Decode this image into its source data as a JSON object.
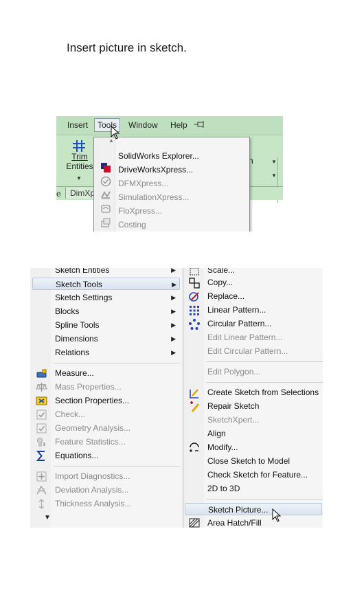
{
  "caption": "Insert picture in sketch.",
  "top": {
    "menubar": [
      "Insert",
      "Tools",
      "Window",
      "Help"
    ],
    "ribbon": {
      "trim_line1": "Trim",
      "trim_line2": "Entities",
      "partial_label": "n"
    },
    "tabs": {
      "partial": "e",
      "dimxpert": "DimXp"
    },
    "tools_menu": [
      {
        "label": "SolidWorks Explorer...",
        "enabled": true
      },
      {
        "label": "DriveWorksXpress...",
        "enabled": true
      },
      {
        "label": "DFMXpress...",
        "enabled": false
      },
      {
        "label": "SimulationXpress...",
        "enabled": false
      },
      {
        "label": "FloXpress...",
        "enabled": false
      },
      {
        "label": "Costing",
        "enabled": false
      }
    ]
  },
  "bottom": {
    "left_menu": [
      {
        "label": "Sketch Entities",
        "submenu": true
      },
      {
        "label": "Sketch Tools",
        "submenu": true,
        "highlighted": true
      },
      {
        "label": "Sketch Settings",
        "submenu": true
      },
      {
        "label": "Blocks",
        "submenu": true
      },
      {
        "label": "Spline Tools",
        "submenu": true
      },
      {
        "label": "Dimensions",
        "submenu": true
      },
      {
        "label": "Relations",
        "submenu": true
      },
      {
        "label": "Measure...",
        "enabled": true,
        "icon": "measure-icon"
      },
      {
        "label": "Mass Properties...",
        "enabled": false,
        "icon": "scale-icon"
      },
      {
        "label": "Section Properties...",
        "enabled": true,
        "icon": "section-properties-icon"
      },
      {
        "label": "Check...",
        "enabled": false,
        "icon": "check-icon"
      },
      {
        "label": "Geometry Analysis...",
        "enabled": false,
        "icon": "geometry-analysis-icon"
      },
      {
        "label": "Feature Statistics...",
        "enabled": false,
        "icon": "feature-statistics-icon"
      },
      {
        "label": "Equations...",
        "enabled": true,
        "icon": "sigma-icon"
      },
      {
        "label": "Import Diagnostics...",
        "enabled": false,
        "icon": "import-diagnostics-icon"
      },
      {
        "label": "Deviation  Analysis...",
        "enabled": false,
        "icon": "deviation-analysis-icon"
      },
      {
        "label": "Thickness Analysis...",
        "enabled": false,
        "icon": "thickness-analysis-icon"
      }
    ],
    "right_menu": [
      {
        "label": "Scale...",
        "enabled": true
      },
      {
        "label": "Copy...",
        "enabled": true
      },
      {
        "label": "Replace...",
        "enabled": true
      },
      {
        "label": "Linear Pattern...",
        "enabled": true
      },
      {
        "label": "Circular Pattern...",
        "enabled": true
      },
      {
        "label": "Edit Linear Pattern...",
        "enabled": false
      },
      {
        "label": "Edit Circular Pattern...",
        "enabled": false
      },
      {
        "label": "Edit Polygon...",
        "enabled": false
      },
      {
        "label": "Create Sketch from Selections",
        "enabled": true
      },
      {
        "label": "Repair Sketch",
        "enabled": true
      },
      {
        "label": "SketchXpert...",
        "enabled": false
      },
      {
        "label": "Align",
        "enabled": true
      },
      {
        "label": "Modify...",
        "enabled": true
      },
      {
        "label": "Close Sketch to Model",
        "enabled": true
      },
      {
        "label": "Check Sketch for Feature...",
        "enabled": true
      },
      {
        "label": "2D to 3D",
        "enabled": true
      },
      {
        "label": "Sketch Picture...",
        "enabled": true,
        "highlighted": true
      },
      {
        "label": "Area Hatch/Fill",
        "enabled": true
      }
    ]
  }
}
